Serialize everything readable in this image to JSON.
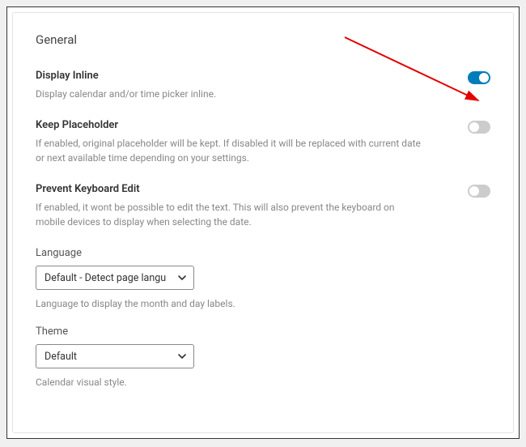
{
  "panel": {
    "title": "General"
  },
  "settings": {
    "displayInline": {
      "label": "Display Inline",
      "desc": "Display calendar and/or time picker inline.",
      "on": true
    },
    "keepPlaceholder": {
      "label": "Keep Placeholder",
      "desc": "If enabled, original placeholder will be kept. If disabled it will be replaced with current date or next available time depending on your settings.",
      "on": false
    },
    "preventKeyboardEdit": {
      "label": "Prevent Keyboard Edit",
      "desc": "If enabled, it wont be possible to edit the text. This will also prevent the keyboard on mobile devices to display when selecting the date.",
      "on": false
    },
    "language": {
      "label": "Language",
      "selected": "Default - Detect page langu",
      "desc": "Language to display the month and day labels."
    },
    "theme": {
      "label": "Theme",
      "selected": "Default",
      "desc": "Calendar visual style."
    }
  },
  "colors": {
    "accent": "#007cba"
  }
}
